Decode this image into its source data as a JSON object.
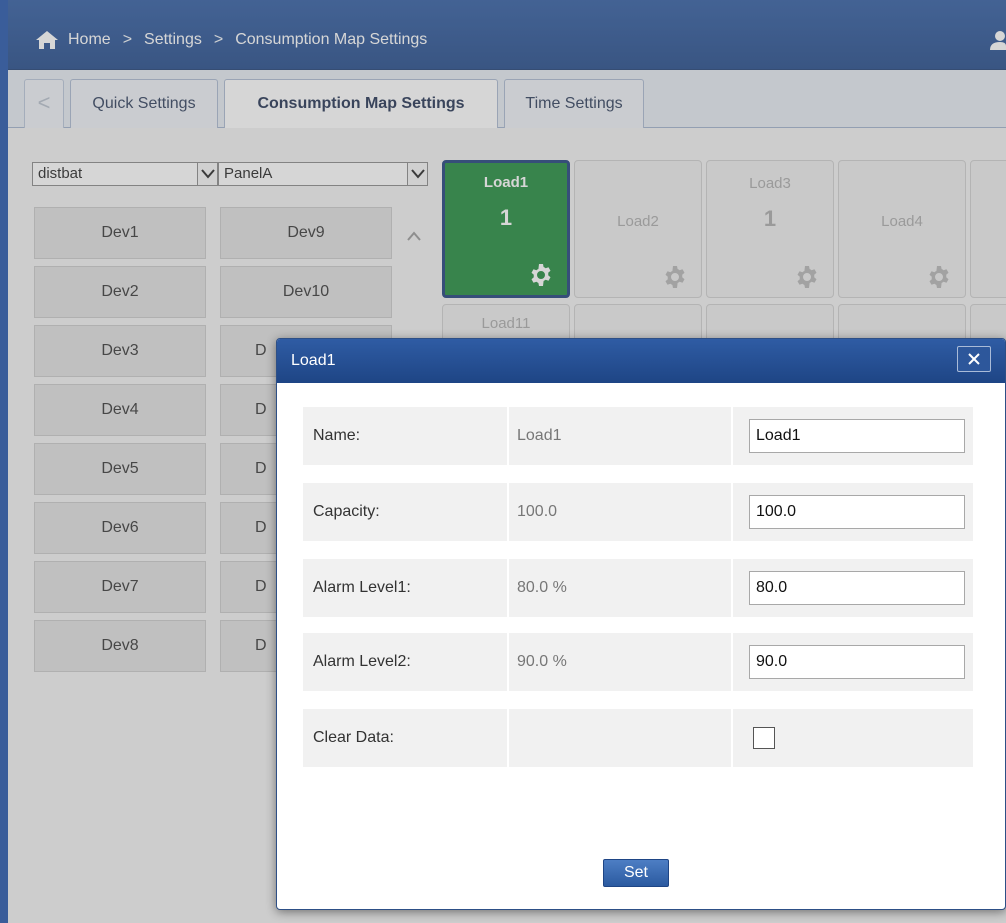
{
  "breadcrumb": {
    "home": "Home",
    "separator": ">",
    "settings": "Settings",
    "current": "Consumption Map Settings"
  },
  "tabs": {
    "back": "<",
    "items": [
      {
        "label": "Quick Settings",
        "active": false
      },
      {
        "label": "Consumption Map Settings",
        "active": true
      },
      {
        "label": "Time Settings",
        "active": false
      }
    ]
  },
  "selectors": {
    "device_group": "distbat",
    "panel": "PanelA"
  },
  "devices": {
    "col1": [
      "Dev1",
      "Dev2",
      "Dev3",
      "Dev4",
      "Dev5",
      "Dev6",
      "Dev7",
      "Dev8"
    ],
    "col2": [
      "Dev9",
      "Dev10",
      "D",
      "D",
      "D",
      "D",
      "D",
      "D"
    ]
  },
  "loads": [
    {
      "name": "Load1",
      "value": "1",
      "active": true
    },
    {
      "name": "Load2",
      "value": ""
    },
    {
      "name": "Load3",
      "value": "1"
    },
    {
      "name": "Load4",
      "value": ""
    },
    {
      "name": "Load11",
      "value": ""
    }
  ],
  "dialog": {
    "title": "Load1",
    "close_label": "×",
    "rows": [
      {
        "label": "Name:",
        "current": "Load1",
        "input": "Load1"
      },
      {
        "label": "Capacity:",
        "current": "100.0",
        "input": "100.0"
      },
      {
        "label": "Alarm Level1:",
        "current": "80.0 %",
        "input": "80.0"
      },
      {
        "label": "Alarm Level2:",
        "current": "90.0 %",
        "input": "90.0"
      }
    ],
    "clear_label": "Clear Data:",
    "clear_checked": false,
    "set_label": "Set"
  },
  "colors": {
    "header": "#1f4788",
    "active_load": "#1e8a3a",
    "dialog_title": "#1e4585"
  }
}
